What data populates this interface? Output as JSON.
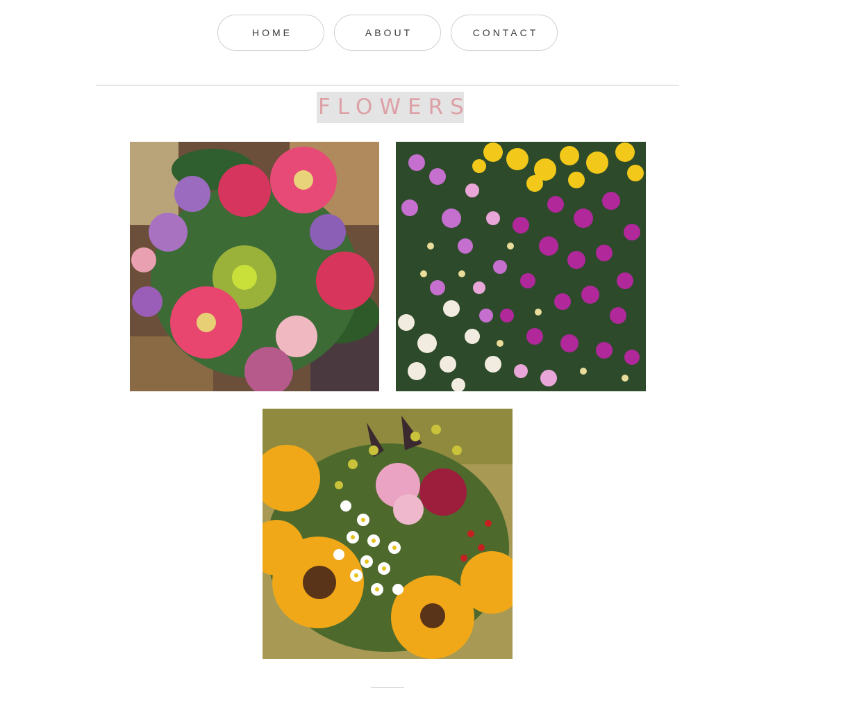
{
  "nav": {
    "items": [
      {
        "label": "HOME"
      },
      {
        "label": "ABOUT"
      },
      {
        "label": "CONTACT"
      }
    ]
  },
  "page_title": "FLOWERS",
  "gallery": {
    "photos": [
      {
        "subject": "mixed bouquet of pink gerberas, purple zinnias and green chrysanthemum",
        "icon": "bouquet-photo"
      },
      {
        "subject": "field of pink, white and yellow chrysanthemums",
        "icon": "flowerbed-photo"
      },
      {
        "subject": "sunflower bouquet with daisies and pink asters",
        "icon": "sunflower-bouquet-photo"
      }
    ]
  },
  "colors": {
    "title_text": "#dda0a6",
    "title_bg": "#e4e4e4",
    "nav_border": "#cfcfcf"
  }
}
